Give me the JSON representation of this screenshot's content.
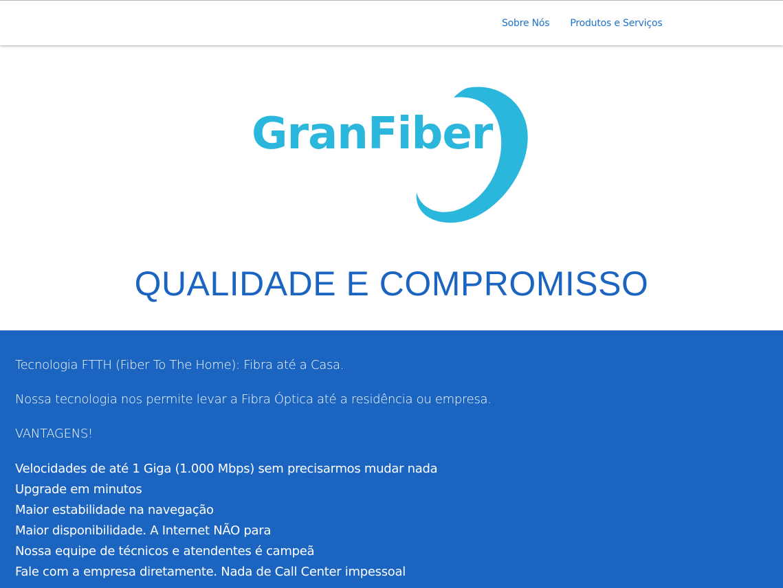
{
  "nav": {
    "items": [
      {
        "label": "Sobre Nós"
      },
      {
        "label": "Produtos e Serviços"
      }
    ]
  },
  "logo": {
    "text": "GranFiber",
    "color": "#2bb6dc"
  },
  "hero": {
    "headline": "QUALIDADE E COMPROMISSO"
  },
  "content": {
    "line1": "Tecnologia FTTH (Fiber To The Home): Fibra até a Casa.",
    "line2": "Nossa tecnologia nos permite levar a Fibra Óptica até a residência ou empresa.",
    "line3": "VANTAGENS!",
    "advantages": [
      "Velocidades de até 1 Giga (1.000 Mbps) sem precisarmos mudar nada",
      "Upgrade em minutos",
      "Maior estabilidade na navegação",
      "Maior disponibilidade. A Internet NÃO para",
      "Nossa equipe de técnicos e atendentes é campeã",
      "Fale com a empresa diretamente. Nada de Call Center impessoal"
    ]
  },
  "colors": {
    "accent_blue": "#1b64c0",
    "nav_link": "#1d72c7",
    "logo_cyan": "#2bb6dc"
  }
}
